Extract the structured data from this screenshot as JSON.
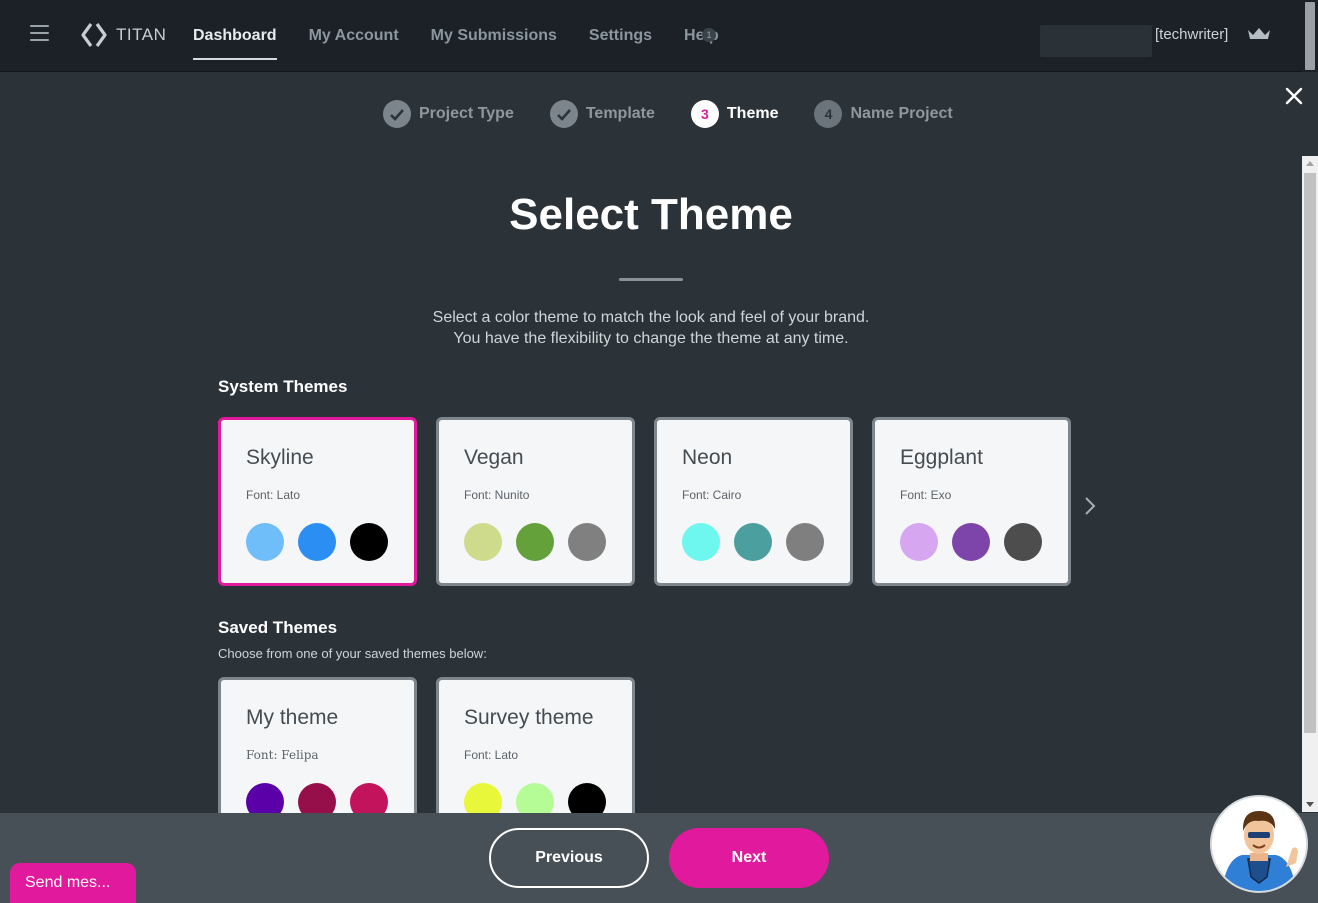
{
  "nav": {
    "brand": "TITAN",
    "items": [
      {
        "label": "Dashboard",
        "active": true
      },
      {
        "label": "My Account",
        "active": false
      },
      {
        "label": "My Submissions",
        "active": false
      },
      {
        "label": "Settings",
        "active": false
      },
      {
        "label": "Help",
        "active": false
      }
    ],
    "help_badge": "1",
    "username": "[techwriter]"
  },
  "stepper": {
    "steps": [
      {
        "number": "1",
        "label": "Project Type",
        "state": "done"
      },
      {
        "number": "2",
        "label": "Template",
        "state": "done"
      },
      {
        "number": "3",
        "label": "Theme",
        "state": "current"
      },
      {
        "number": "4",
        "label": "Name Project",
        "state": "todo"
      }
    ]
  },
  "page": {
    "title": "Select Theme",
    "subtitle_line1": "Select a color theme to match the look and feel of your brand.",
    "subtitle_line2": "You have the flexibility to change the theme at any time."
  },
  "system_themes": {
    "title": "System Themes",
    "cards": [
      {
        "name": "Skyline",
        "font": "Font: Lato",
        "selected": true,
        "colors": [
          "#6fbdf9",
          "#2a8ef3",
          "#000000"
        ]
      },
      {
        "name": "Vegan",
        "font": "Font: Nunito",
        "selected": false,
        "colors": [
          "#cfdb8c",
          "#64a13a",
          "#808080"
        ]
      },
      {
        "name": "Neon",
        "font": "Font: Cairo",
        "selected": false,
        "colors": [
          "#6ef7ef",
          "#4b9f9f",
          "#7f7f7f"
        ]
      },
      {
        "name": "Eggplant",
        "font": "Font: Exo",
        "selected": false,
        "colors": [
          "#d7a6f1",
          "#7d45a9",
          "#4d4d4d"
        ]
      }
    ]
  },
  "saved_themes": {
    "title": "Saved Themes",
    "subtitle": "Choose from one of your saved themes below:",
    "cards": [
      {
        "name": "My theme",
        "font": "Font: Felipa",
        "colors": [
          "#5b00a8",
          "#960f4a",
          "#c3135d"
        ]
      },
      {
        "name": "Survey theme",
        "font": "Font: Lato",
        "colors": [
          "#e9f73a",
          "#b5fb96",
          "#000000"
        ]
      }
    ]
  },
  "footer": {
    "previous_label": "Previous",
    "next_label": "Next"
  },
  "chat": {
    "label": "Send mes..."
  },
  "colors": {
    "accent": "#e0199d",
    "background": "#2c3338",
    "topbar": "#1b2126",
    "footer": "#474f57"
  },
  "icons": {
    "menu": "hamburger-icon",
    "logo": "titan-logo-icon",
    "crown": "crown-icon",
    "check": "checkmark-icon",
    "close": "close-icon",
    "next": "chevron-right-icon"
  }
}
